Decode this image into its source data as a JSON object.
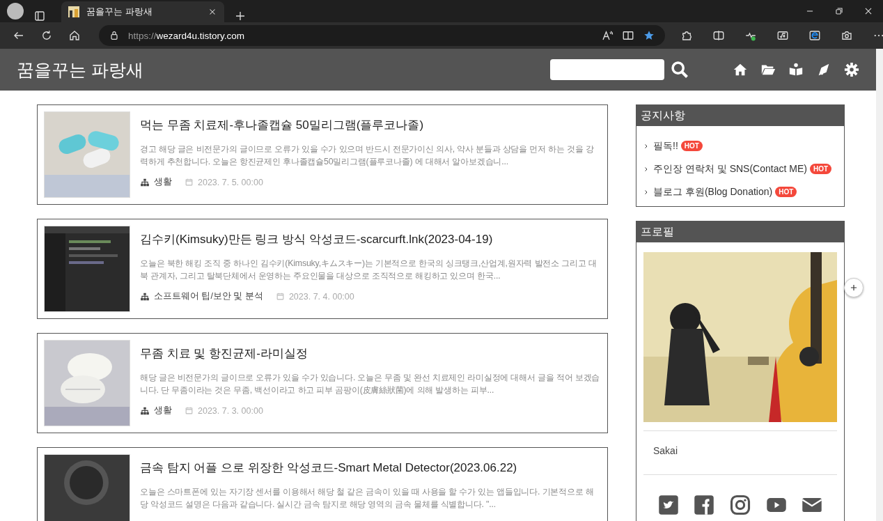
{
  "browser": {
    "tab": {
      "title": "꿈을꾸는 파랑새",
      "selected": true
    },
    "url_scheme": "https://",
    "url_host": "wezard4u.tistory.com",
    "favorite": true
  },
  "blog": {
    "title": "꿈을꾸는 파랑새"
  },
  "posts": [
    {
      "title": "먹는 무좀 치료제-후나졸캡슐 50밀리그램(플루코나졸)",
      "summary": "경고 해당 글은 비전문가의 글이므로 오류가 있을 수가 있으며 반드시 전문가이신 의사, 약사 분들과 상담을 먼저 하는 것을 강력하게 추천합니다. 오늘은 항진균제인 후나졸캡슐50밀리그램(플루코나졸) 에 대해서 알아보겠습니...",
      "category": "생활",
      "date": "2023. 7. 5. 00:00"
    },
    {
      "title": "김수키(Kimsuky)만든 링크 방식 악성코드-scarcurft.lnk(2023-04-19)",
      "summary": "오늘은 북한 해킹 조직 중 하나인 김수키(Kimsuky,キムスキー)는 기본적으로 한국의 싱크탱크,산업계,원자력 발전소 그리고 대북 관계자, 그리고 탈북단체에서 운영하는 주요인물을 대상으로 조직적으로 해킹하고 있으며 한국...",
      "category": "소프트웨어 팁/보안 및 분석",
      "date": "2023. 7. 4. 00:00"
    },
    {
      "title": "무좀 치료 및 항진균제-라미실정",
      "summary": "해당 글은 비전문가의 글이므로 오류가 있을 수가 있습니다. 오늘은 무좀 및 완선 치료제인 라미실정에 대해서 글을 적어 보겠습니다. 단 무좀이라는 것은 무좀, 백선이라고 하고 피부 곰팡이(皮膚絲狀菌)에 의해 발생하는 피부...",
      "category": "생활",
      "date": "2023. 7. 3. 00:00"
    },
    {
      "title": "금속 탐지 어플 으로 위장한 악성코드-Smart Metal Detector(2023.06.22)",
      "summary": "오늘은 스마트폰에 있는 자기장 센서를 이용해서 해당 철 같은 금속이 있을 때 사용을 할 수가 있는 앱들입니다. 기본적으로 해당 악성코드 설명은 다음과 같습니다. 실시간 금속 탐지로 해당 영역의 금속 물체를 식별합니다. \"..."
    }
  ],
  "notice": {
    "title": "공지사항",
    "items": [
      {
        "label": "필독!!",
        "badge": "HOT"
      },
      {
        "label": "주인장 연락처 및 SNS(Contact ME)",
        "badge": "HOT"
      },
      {
        "label": "블로그 후원(Blog Donation)",
        "badge": "HOT"
      }
    ]
  },
  "profile": {
    "title": "프로필",
    "name": "Sakai"
  }
}
